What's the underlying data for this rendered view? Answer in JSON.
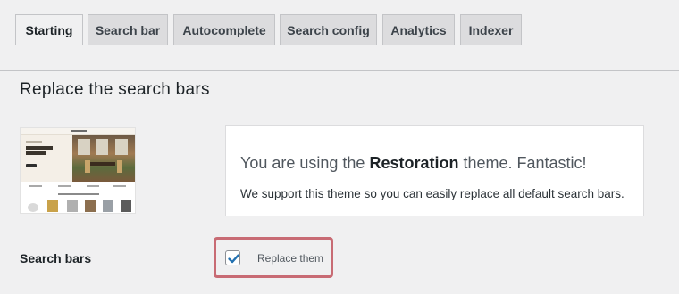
{
  "tabs": [
    {
      "label": "Starting",
      "active": true
    },
    {
      "label": "Search bar",
      "active": false
    },
    {
      "label": "Autocomplete",
      "active": false
    },
    {
      "label": "Search config",
      "active": false
    },
    {
      "label": "Analytics",
      "active": false
    },
    {
      "label": "Indexer",
      "active": false
    }
  ],
  "section": {
    "title": "Replace the search bars"
  },
  "theme_preview": {
    "icon": "theme-screenshot"
  },
  "notice": {
    "title_prefix": "You are using the ",
    "theme_name": "Restoration",
    "title_suffix": " theme. Fantastic!",
    "text": "We support this theme so you can easily replace all default search bars."
  },
  "search_bars": {
    "label": "Search bars",
    "checkbox_label": "Replace them",
    "checked": true
  },
  "colors": {
    "accent": "#2271b1",
    "highlight_border": "#c86b74"
  }
}
